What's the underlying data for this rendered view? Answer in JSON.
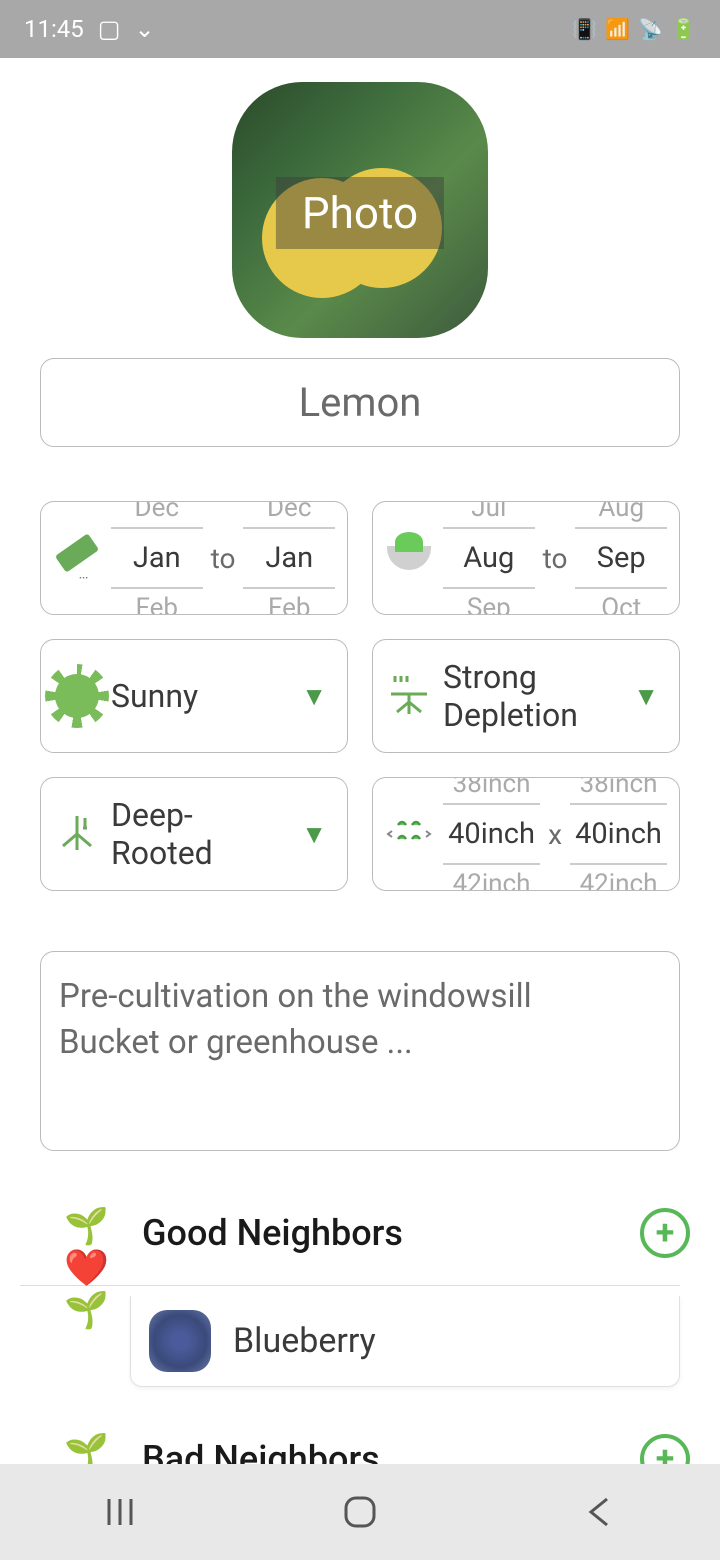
{
  "status": {
    "time": "11:45"
  },
  "photo_label": "Photo",
  "plant_name": "Lemon",
  "sow": {
    "prev": "Dec",
    "from": "Jan",
    "next": "Feb",
    "sep": "to",
    "prev2": "Dec",
    "to": "Jan",
    "next2": "Feb"
  },
  "harvest": {
    "prev": "Jul",
    "from": "Aug",
    "next": "Sep",
    "sep": "to",
    "prev2": "Aug",
    "to": "Sep",
    "next2": "Oct"
  },
  "light": "Sunny",
  "depletion": "Strong Depletion",
  "root": "Deep-Rooted",
  "spacing": {
    "prev": "38inch",
    "w": "40inch",
    "next": "42inch",
    "sep": "x",
    "prev2": "38inch",
    "h": "40inch",
    "next2": "42inch"
  },
  "notes": "Pre-cultivation on the windowsill\n Bucket or greenhouse ...",
  "good_neighbors_title": "Good Neighbors",
  "good_neighbor_1": "Blueberry",
  "bad_neighbors_title": "Bad Neighbors"
}
